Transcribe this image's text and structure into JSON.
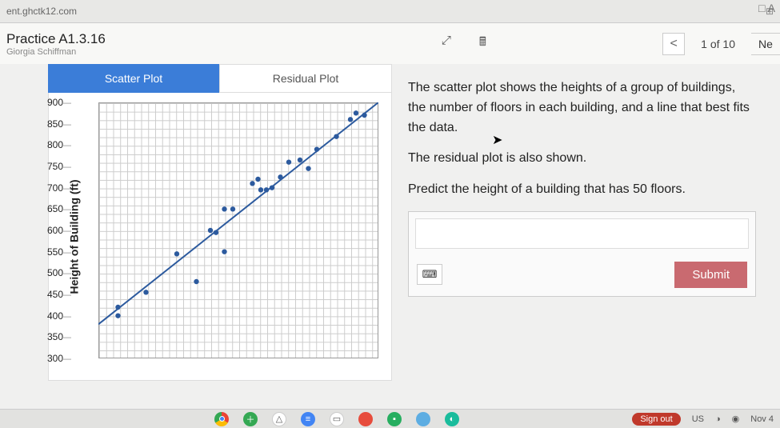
{
  "browser": {
    "url_fragment": "ent.ghctk12.com",
    "apps_icon": "⊞",
    "folder_label": "A"
  },
  "header": {
    "title": "Practice A1.3.16",
    "subtitle": "Giorgia Schiffman",
    "expand_icon": "⤢",
    "calc_icon": "🖩",
    "prev": "<",
    "counter": "1 of 10",
    "next": "Ne"
  },
  "tabs": {
    "scatter": "Scatter Plot",
    "residual": "Residual Plot"
  },
  "chart_data": {
    "type": "scatter",
    "title": "",
    "xlabel": "",
    "ylabel": "Height of Building (ft)",
    "ylim": [
      300,
      900
    ],
    "xlim": [
      0,
      100
    ],
    "y_ticks": [
      300,
      350,
      400,
      450,
      500,
      550,
      600,
      650,
      700,
      750,
      800,
      850,
      900
    ],
    "points_xy": [
      [
        7,
        420
      ],
      [
        7,
        400
      ],
      [
        17,
        455
      ],
      [
        28,
        545
      ],
      [
        35,
        480
      ],
      [
        40,
        600
      ],
      [
        42,
        595
      ],
      [
        45,
        650
      ],
      [
        45,
        550
      ],
      [
        48,
        650
      ],
      [
        55,
        710
      ],
      [
        57,
        720
      ],
      [
        58,
        695
      ],
      [
        60,
        695
      ],
      [
        62,
        700
      ],
      [
        65,
        725
      ],
      [
        68,
        760
      ],
      [
        72,
        765
      ],
      [
        75,
        745
      ],
      [
        78,
        790
      ],
      [
        85,
        820
      ],
      [
        90,
        860
      ],
      [
        92,
        875
      ],
      [
        95,
        870
      ]
    ],
    "fit_line": {
      "x1": 0,
      "y1": 380,
      "x2": 100,
      "y2": 900
    }
  },
  "prose": {
    "p1": "The scatter plot shows the heights of a group of buildings, the number of floors in each building, and a line that best fits the data.",
    "p2": "The residual plot is also shown.",
    "p3a": "Predict the height of a building that has ",
    "p3val": "50",
    "p3b": " floors."
  },
  "answer": {
    "keyboard_icon": "⌨",
    "submit": "Submit"
  },
  "taskbar": {
    "signout": "Sign out",
    "lang": "US",
    "date": "Nov 4"
  }
}
